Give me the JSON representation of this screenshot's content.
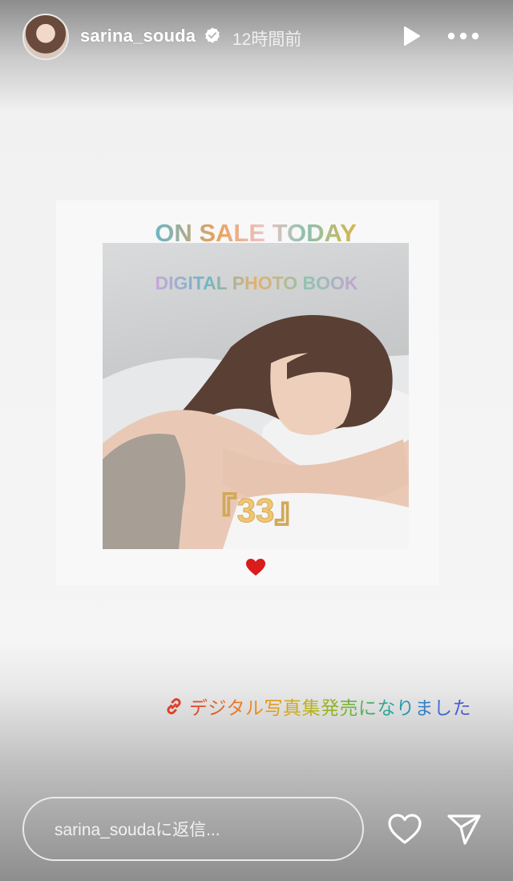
{
  "header": {
    "username": "sarina_souda",
    "timestamp": "12時間前",
    "avatar_icon": "profile-avatar",
    "verified_icon": "verified-badge-icon",
    "play_icon": "play-icon",
    "more_icon": "more-icon"
  },
  "post": {
    "headline": "ON SALE TODAY",
    "subheadline": "DIGITAL PHOTO BOOK",
    "book_title": "『33』",
    "heart_icon": "heart-icon"
  },
  "link_sticker": {
    "icon": "link-icon",
    "text": "デジタル写真集発売になりました"
  },
  "footer": {
    "reply_placeholder": "sarina_soudaに返信...",
    "like_icon": "heart-outline-icon",
    "send_icon": "send-icon"
  },
  "colors": {
    "heart": "#d91c1c",
    "link_gradient_start": "#e0402a",
    "link_gradient_end": "#5b50c8"
  }
}
